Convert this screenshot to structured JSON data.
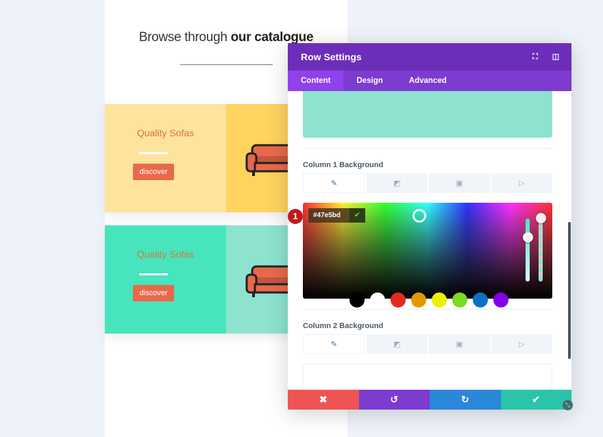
{
  "page": {
    "title_light": "Browse through ",
    "title_bold": "our catalogue",
    "rows": [
      {
        "title": "Quality Sofas",
        "button": "discover",
        "col1_color": "#fde39b",
        "col2_color": "#fed35e"
      },
      {
        "title": "Quality Sofas",
        "button": "discover",
        "col1_color": "#47e5bd",
        "col2_color": "#8de3cf"
      }
    ]
  },
  "modal": {
    "title": "Row Settings",
    "header_icons": [
      "fullscreen-icon",
      "sidebar-toggle-icon"
    ],
    "tabs": [
      {
        "label": "Content",
        "active": true
      },
      {
        "label": "Design",
        "active": false
      },
      {
        "label": "Advanced",
        "active": false
      }
    ],
    "column1_label": "Column 1 Background",
    "column2_label": "Column 2 Background",
    "bg_type_tabs": [
      "color-icon",
      "gradient-icon",
      "image-icon",
      "video-icon"
    ],
    "color_picker": {
      "hex_value": "#47e5bd",
      "confirm_icon": "check-icon",
      "swatches": [
        "#000000",
        "#ffffff",
        "#e02b20",
        "#e09900",
        "#edf000",
        "#7cda24",
        "#0c71c3",
        "#8300e9"
      ]
    },
    "step_badge": "1",
    "footer": {
      "cancel_icon": "close-icon",
      "undo_icon": "undo-icon",
      "redo_icon": "redo-icon",
      "save_icon": "check-icon"
    }
  }
}
